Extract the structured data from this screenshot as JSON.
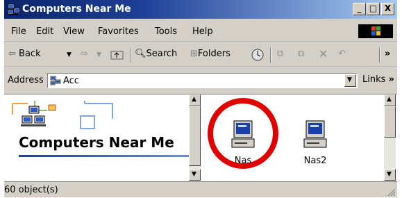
{
  "window": {
    "title": "Computers Near Me",
    "controls": [
      "_",
      "□",
      "X"
    ]
  },
  "menubar": {
    "items": [
      "File",
      "Edit",
      "View",
      "Favorites",
      "Tools",
      "Help"
    ]
  },
  "toolbar": {
    "back_label": "Back",
    "search_label": "Search",
    "folders_label": "Folders",
    "overflow": "»"
  },
  "address": {
    "label": "Address",
    "value": "Acc",
    "links_label": "Links",
    "links_overflow": "»"
  },
  "left_pane": {
    "title": "Computers Near Me"
  },
  "items": [
    {
      "label": "Nas",
      "highlighted": true
    },
    {
      "label": "Nas2",
      "highlighted": false
    }
  ],
  "status": {
    "text": "60 object(s)"
  },
  "colors": {
    "title_bar_start": "#0a246a",
    "title_bar_end": "#a6caf0",
    "highlight_ring": "#e00000",
    "chrome": "#d4d0c8"
  }
}
